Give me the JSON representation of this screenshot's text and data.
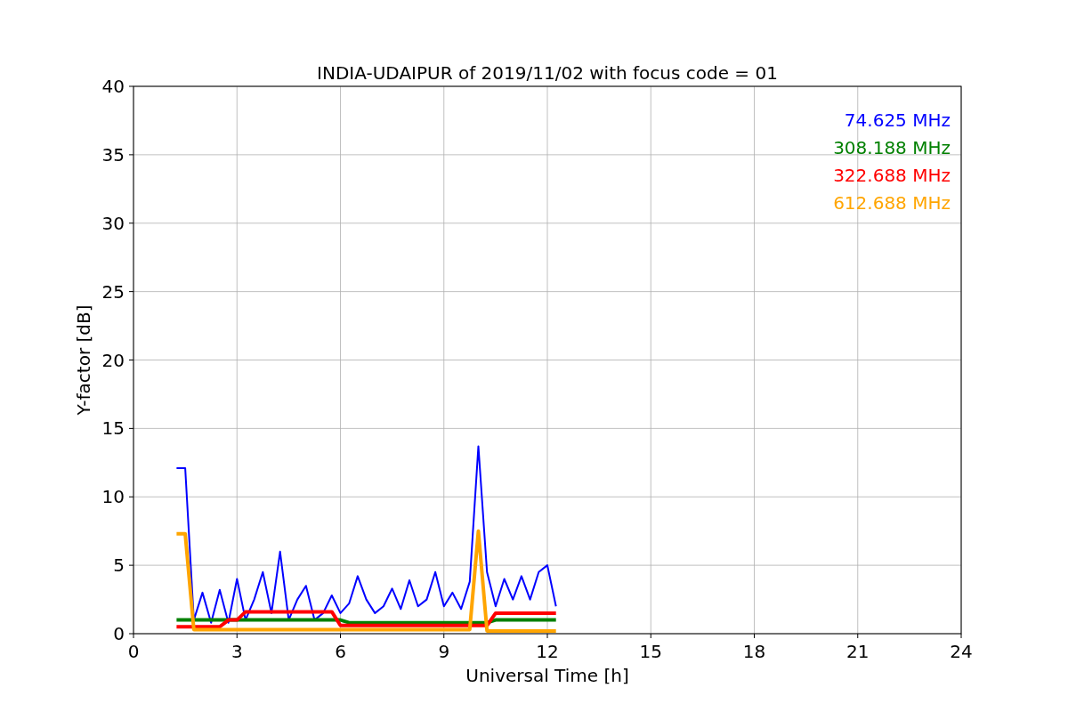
{
  "figure": {
    "chart_data": {
      "type": "line",
      "title": "INDIA-UDAIPUR of 2019/11/02 with focus code = 01",
      "xlabel": "Universal Time [h]",
      "ylabel": "Y-factor [dB]",
      "x": [
        1.25,
        1.5,
        1.75,
        2.0,
        2.25,
        2.5,
        2.75,
        3.0,
        3.25,
        3.5,
        3.75,
        4.0,
        4.25,
        4.5,
        4.75,
        5.0,
        5.25,
        5.5,
        5.75,
        6.0,
        6.25,
        6.5,
        6.75,
        7.0,
        7.25,
        7.5,
        7.75,
        8.0,
        8.25,
        8.5,
        8.75,
        9.0,
        9.25,
        9.5,
        9.75,
        10.0,
        10.25,
        10.5,
        10.75,
        11.0,
        11.25,
        11.5,
        11.75,
        12.0,
        12.25
      ],
      "series": [
        {
          "name": "74.625 MHz",
          "color": "#0000ff",
          "values": [
            12.1,
            12.1,
            1.0,
            3.0,
            0.8,
            3.2,
            0.8,
            4.0,
            1.0,
            2.5,
            4.5,
            1.5,
            6.0,
            1.0,
            2.5,
            3.5,
            1.0,
            1.5,
            2.8,
            1.5,
            2.2,
            4.2,
            2.5,
            1.5,
            2.0,
            3.3,
            1.8,
            3.9,
            2.0,
            2.5,
            4.5,
            2.0,
            3.0,
            1.8,
            3.8,
            13.7,
            4.5,
            2.0,
            4.0,
            2.5,
            4.2,
            2.5,
            4.5,
            5.0,
            2.0
          ]
        },
        {
          "name": "308.188 MHz",
          "color": "#008000",
          "values": [
            1.0,
            1.0,
            1.0,
            1.0,
            1.0,
            1.0,
            1.0,
            1.0,
            1.0,
            1.0,
            1.0,
            1.0,
            1.0,
            1.0,
            1.0,
            1.0,
            1.0,
            1.0,
            1.0,
            1.0,
            0.8,
            0.8,
            0.8,
            0.8,
            0.8,
            0.8,
            0.8,
            0.8,
            0.8,
            0.8,
            0.8,
            0.8,
            0.8,
            0.8,
            0.8,
            0.8,
            0.8,
            1.0,
            1.0,
            1.0,
            1.0,
            1.0,
            1.0,
            1.0,
            1.0
          ]
        },
        {
          "name": "322.688 MHz",
          "color": "#ff0000",
          "values": [
            0.5,
            0.5,
            0.5,
            0.5,
            0.5,
            0.5,
            1.0,
            1.0,
            1.6,
            1.6,
            1.6,
            1.6,
            1.6,
            1.6,
            1.6,
            1.6,
            1.6,
            1.6,
            1.6,
            0.6,
            0.6,
            0.6,
            0.6,
            0.6,
            0.6,
            0.6,
            0.6,
            0.6,
            0.6,
            0.6,
            0.6,
            0.6,
            0.6,
            0.6,
            0.6,
            0.6,
            0.6,
            1.5,
            1.5,
            1.5,
            1.5,
            1.5,
            1.5,
            1.5,
            1.5
          ]
        },
        {
          "name": "612.688 MHz",
          "color": "#ffa500",
          "values": [
            7.3,
            7.3,
            0.3,
            0.3,
            0.3,
            0.3,
            0.3,
            0.3,
            0.3,
            0.3,
            0.3,
            0.3,
            0.3,
            0.3,
            0.3,
            0.3,
            0.3,
            0.3,
            0.3,
            0.3,
            0.3,
            0.3,
            0.3,
            0.3,
            0.3,
            0.3,
            0.3,
            0.3,
            0.3,
            0.3,
            0.3,
            0.3,
            0.3,
            0.3,
            0.3,
            7.5,
            0.2,
            0.2,
            0.2,
            0.2,
            0.2,
            0.2,
            0.2,
            0.2,
            0.2
          ]
        }
      ],
      "grid": true,
      "xlim": [
        0,
        24
      ],
      "ylim": [
        0,
        40
      ],
      "xticks": [
        0,
        3,
        6,
        9,
        12,
        15,
        18,
        21,
        24
      ],
      "yticks": [
        0,
        5,
        10,
        15,
        20,
        25,
        30,
        35,
        40
      ]
    }
  }
}
